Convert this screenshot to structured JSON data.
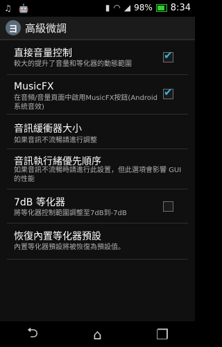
{
  "status": {
    "battery_text": "98%",
    "time": "8:34"
  },
  "header": {
    "icon_text": "ヨ",
    "title": "高級微調"
  },
  "settings": [
    {
      "title": "直接音量控制",
      "summary": "較大的提升了音量和等化器的動態範圍",
      "checked": true
    },
    {
      "title": "MusicFX",
      "summary": "在音頻/音量頁面中啟用MusicFX按鈕(Android系統音效)",
      "checked": true
    },
    {
      "title": "音訊緩衝器大小",
      "summary": "如果音訊不流暢請進行調整"
    },
    {
      "title": "音訊執行緒優先順序",
      "summary": "如果音訊不流暢時請進行此設置，但此選項會影響 GUI 的性能"
    },
    {
      "title": "7dB 等化器",
      "summary": "將等化器控制範圍調整至7dB到-7dB",
      "checked": false
    },
    {
      "title": "恢復內置等化器預設",
      "summary": "內置等化器預設將被恢復為預設值。"
    }
  ],
  "colors": {
    "accent": "#33b5e5",
    "background": "#101010"
  }
}
